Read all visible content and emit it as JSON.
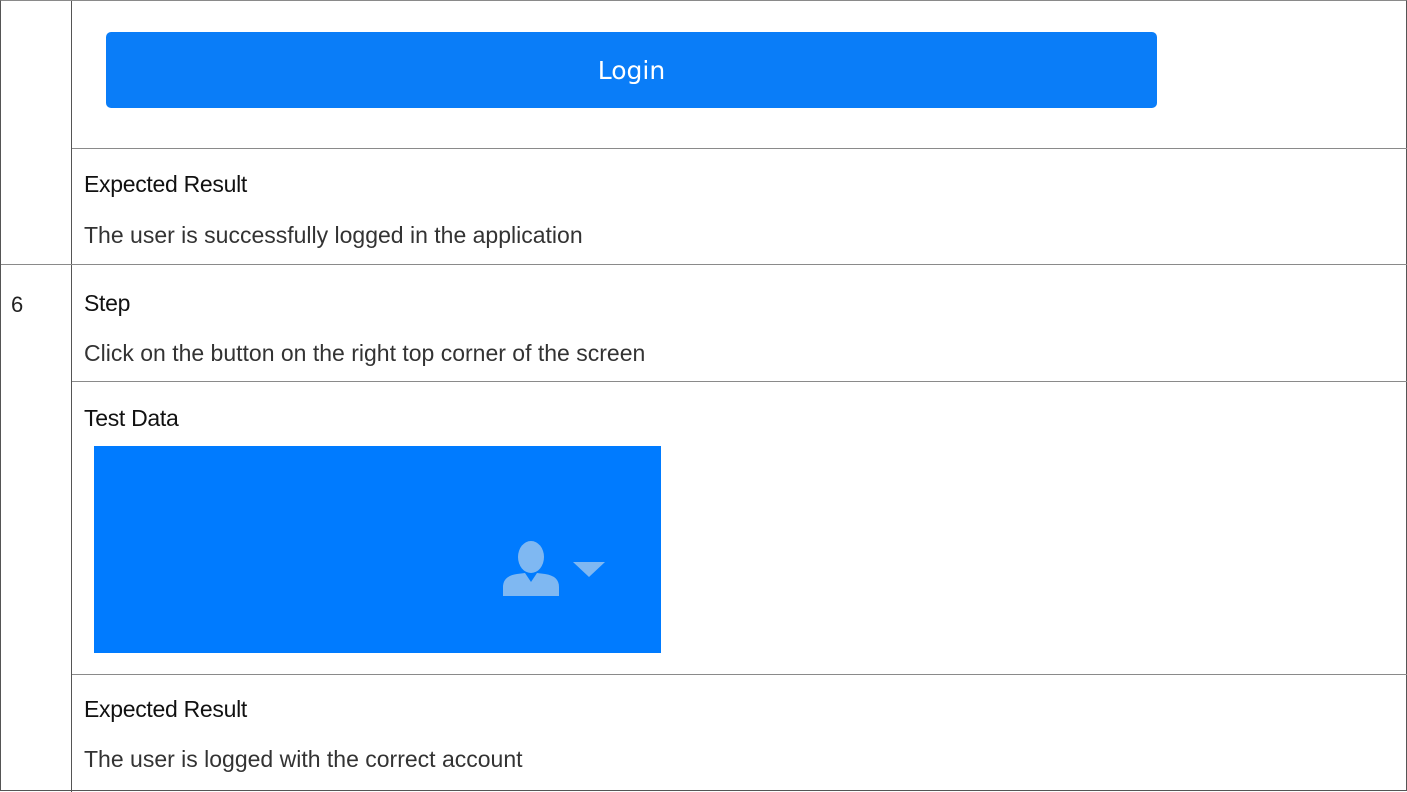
{
  "upper": {
    "login_button_label": "Login",
    "expected_heading": "Expected Result",
    "expected_text": "The user is successfully logged in the application"
  },
  "step6": {
    "number": "6",
    "step_heading": "Step",
    "step_text": "Click on the button on the right top corner of the screen",
    "test_data_heading": "Test Data",
    "test_data_image": {
      "background_color": "#007BFF",
      "icons": [
        "user-icon",
        "caret-down-icon"
      ]
    },
    "expected_heading": "Expected Result",
    "expected_text": "The user is logged with the correct account"
  },
  "colors": {
    "button_blue": "#0A7DF8",
    "header_blue": "#007BFF",
    "icon_tint": "#7FB8F2"
  }
}
